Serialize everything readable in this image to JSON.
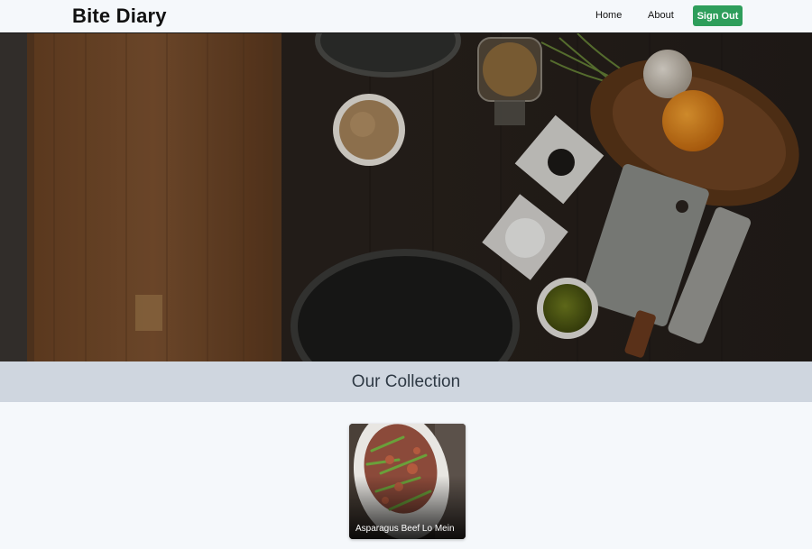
{
  "header": {
    "brand": "Bite Diary",
    "nav": {
      "home": "Home",
      "about": "About",
      "sign_out": "Sign Out"
    },
    "sign_out_color": "#2e9e5b"
  },
  "hero": {
    "image": "dark wooden kitchen table with cutting board, spice bowls, cleaver, orange and garlic"
  },
  "collection": {
    "title": "Our Collection",
    "banner_color": "#cfd6df"
  },
  "recipes": [
    {
      "title": "Asparagus Beef Lo Mein",
      "image": "asparagus beef lo mein on white platter"
    }
  ]
}
